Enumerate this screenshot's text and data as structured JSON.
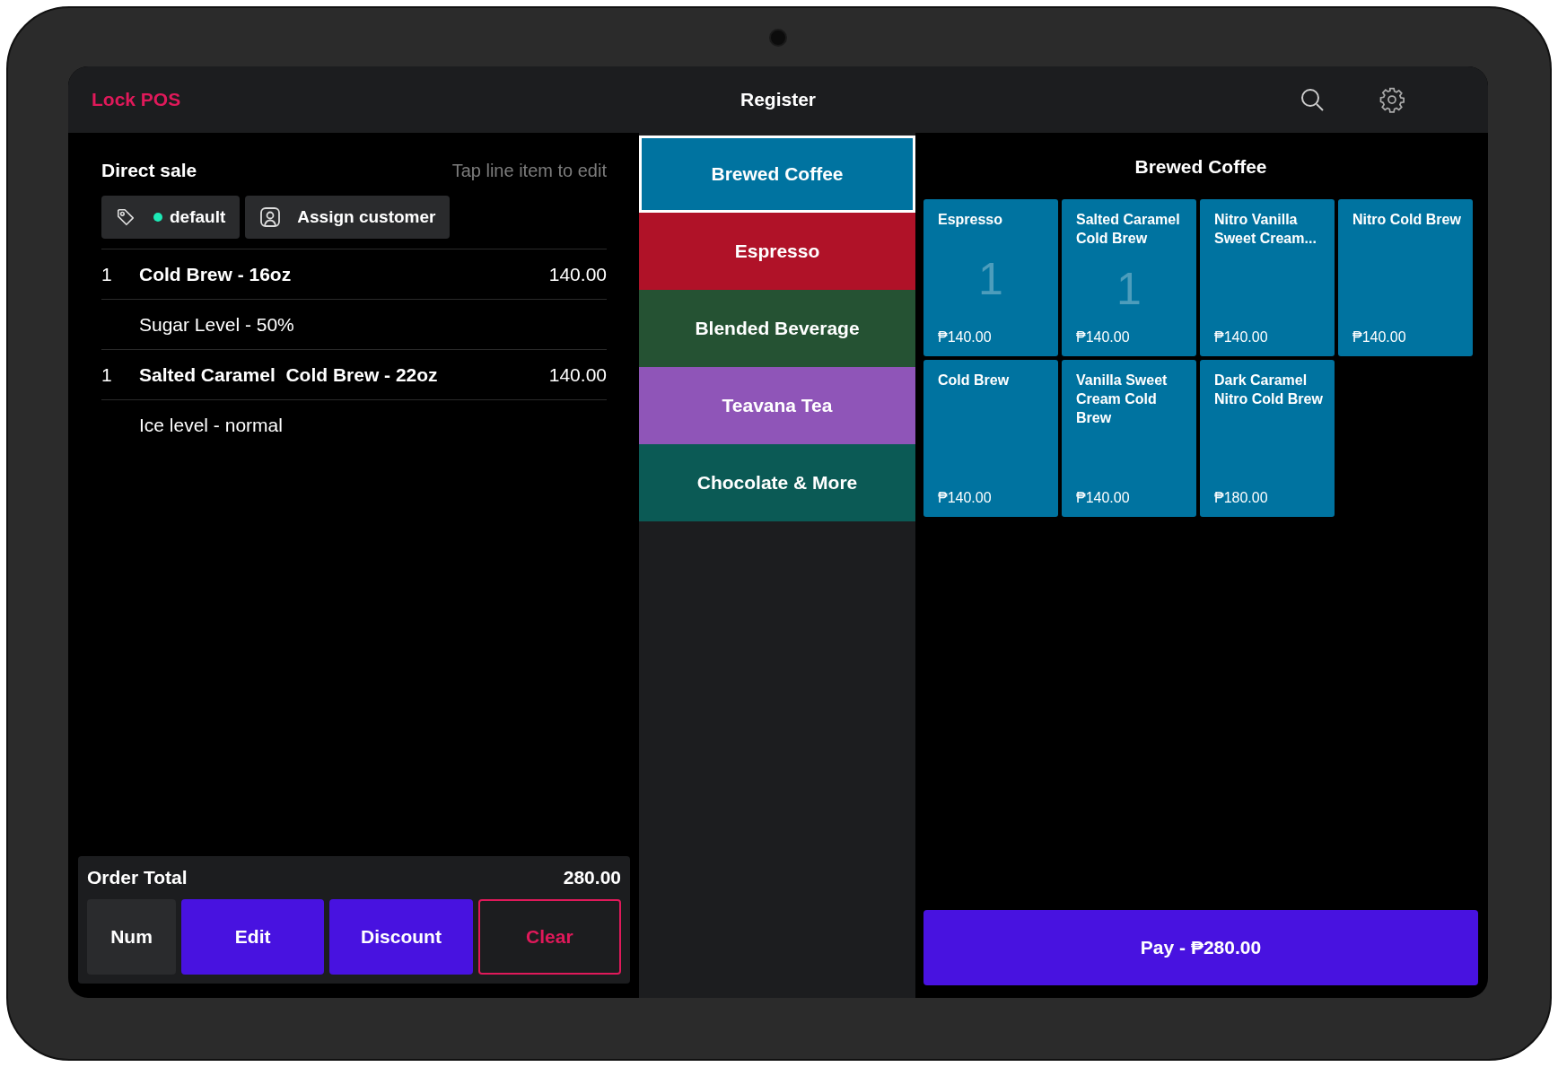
{
  "header": {
    "brand": "Lock POS",
    "title": "Register"
  },
  "order": {
    "title": "Direct sale",
    "hint": "Tap line item to edit",
    "price_list": {
      "label": "default",
      "color": "#1de9b6"
    },
    "assign_customer": "Assign customer",
    "lines": [
      {
        "kind": "item",
        "qty": "1",
        "name": "Cold Brew - 16oz",
        "price": "140.00"
      },
      {
        "kind": "modifier",
        "name": "Sugar Level - 50%"
      },
      {
        "kind": "item",
        "qty": "1",
        "name": "Salted Caramel  Cold Brew - 22oz",
        "price": "140.00"
      },
      {
        "kind": "modifier",
        "name": "Ice level - normal"
      }
    ],
    "total_label": "Order Total",
    "total": "280.00",
    "buttons": [
      {
        "kind": "plain",
        "label": "Num"
      },
      {
        "kind": "primary",
        "label": "Edit"
      },
      {
        "kind": "primary",
        "label": "Discount"
      },
      {
        "kind": "danger",
        "label": "Clear"
      }
    ]
  },
  "categories": [
    {
      "label": "Brewed Coffee",
      "color": "#0073a0",
      "selected": true
    },
    {
      "label": "Espresso",
      "color": "#b01228",
      "selected": false
    },
    {
      "label": "Blended Beverage",
      "color": "#255233",
      "selected": false
    },
    {
      "label": "Teavana Tea",
      "color": "#8f55b8",
      "selected": false
    },
    {
      "label": "Chocolate & More",
      "color": "#0b5a55",
      "selected": false
    }
  ],
  "products": {
    "title": "Brewed Coffee",
    "items": [
      {
        "name": "Espresso",
        "count": "1",
        "price": "₱140.00"
      },
      {
        "name": "Salted Caramel Cold Brew",
        "count": "1",
        "price": "₱140.00"
      },
      {
        "name": "Nitro Vanilla Sweet Cream...",
        "price": "₱140.00"
      },
      {
        "name": "Nitro Cold Brew",
        "price": "₱140.00"
      },
      {
        "name": "Cold Brew",
        "price": "₱140.00"
      },
      {
        "name": "Vanilla Sweet Cream Cold Brew",
        "price": "₱140.00"
      },
      {
        "name": "Dark Caramel Nitro Cold Brew",
        "price": "₱180.00"
      }
    ]
  },
  "pay_button": "Pay - ₱280.00"
}
